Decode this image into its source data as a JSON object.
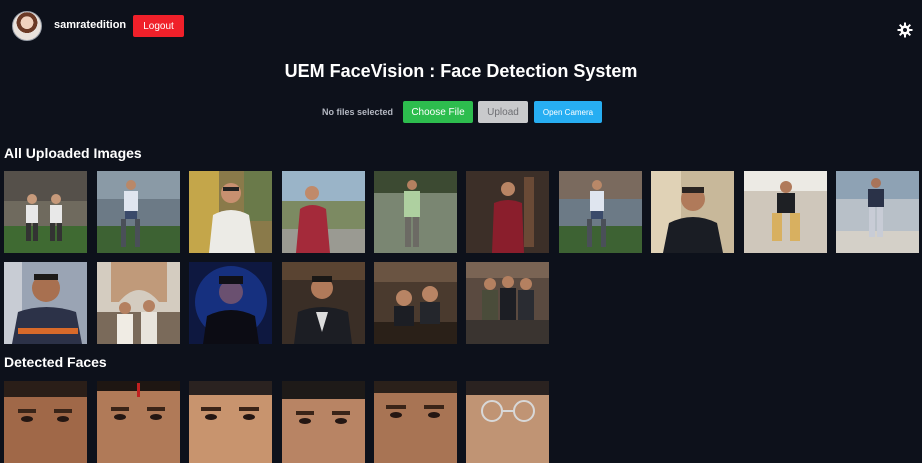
{
  "user": {
    "username": "samratedition"
  },
  "header": {
    "logout_label": "Logout",
    "theme_icon": "gear-icon"
  },
  "page": {
    "title": "UEM FaceVision : Face Detection System"
  },
  "upload": {
    "file_status": "No files selected",
    "choose_label": "Choose File",
    "upload_label": "Upload",
    "camera_label": "Open Camera"
  },
  "sections": {
    "uploaded_title": "All Uploaded Images",
    "faces_title": "Detected Faces"
  },
  "colors": {
    "background": "#0d111b",
    "logout": "#f0202a",
    "choose": "#2dbd4e",
    "upload_disabled": "#c9cacc",
    "camera": "#27aef2"
  }
}
